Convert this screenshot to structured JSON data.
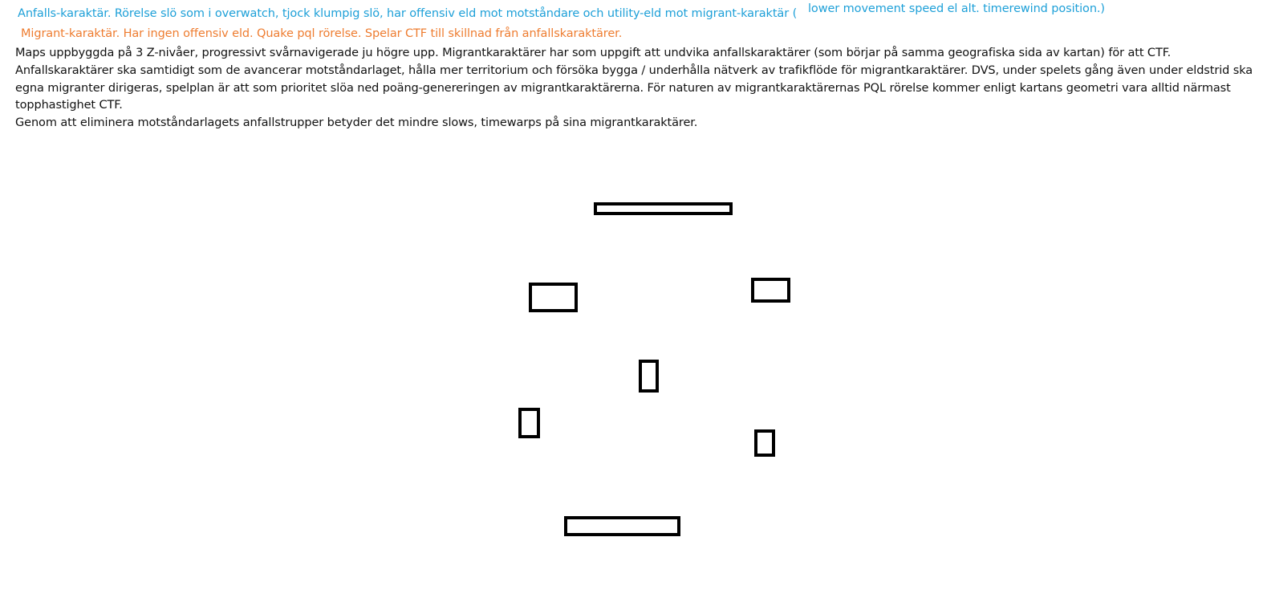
{
  "notes": {
    "attacker_line": "Anfalls-karaktär. Rörelse slö som i overwatch, tjock klumpig slö, har offensiv eld mot motståndare och utility-eld mot migrant-karaktär (",
    "attacker_note": "lower movement speed el alt. timerewind position.)",
    "migrant_line": "Migrant-karaktär. Har ingen offensiv eld. Quake pql rörelse. Spelar CTF till skillnad från anfallskaraktärer.",
    "body_lines": [
      "Maps uppbyggda på 3 Z-nivåer, progressivt svårnavigerade ju högre upp. Migrantkaraktärer har som uppgift att undvika anfallskaraktärer (som börjar på samma geografiska sida av kartan) för att CTF.",
      "Anfallskaraktärer ska samtidigt som de avancerar motståndarlaget, hålla mer territorium och försöka bygga / underhålla nätverk av trafikflöde för migrantkaraktärer. DVS, under spelets gång även under eldstrid ska",
      "egna migranter dirigeras, spelplan är att som prioritet slöa ned poäng-genereringen av migrantkaraktärerna. För naturen av migrantkaraktärernas PQL rörelse kommer enligt kartans geometri vara alltid närmast",
      "topphastighet CTF.",
      "Genom att eliminera motståndarlagets anfallstrupper betyder det mindre slows, timewarps på sina migrantkaraktärer."
    ]
  },
  "colors": {
    "attacker_text": "#1ea0d8",
    "migrant_text": "#ee7d31",
    "body_text": "#111111",
    "shape_stroke": "#000000"
  }
}
